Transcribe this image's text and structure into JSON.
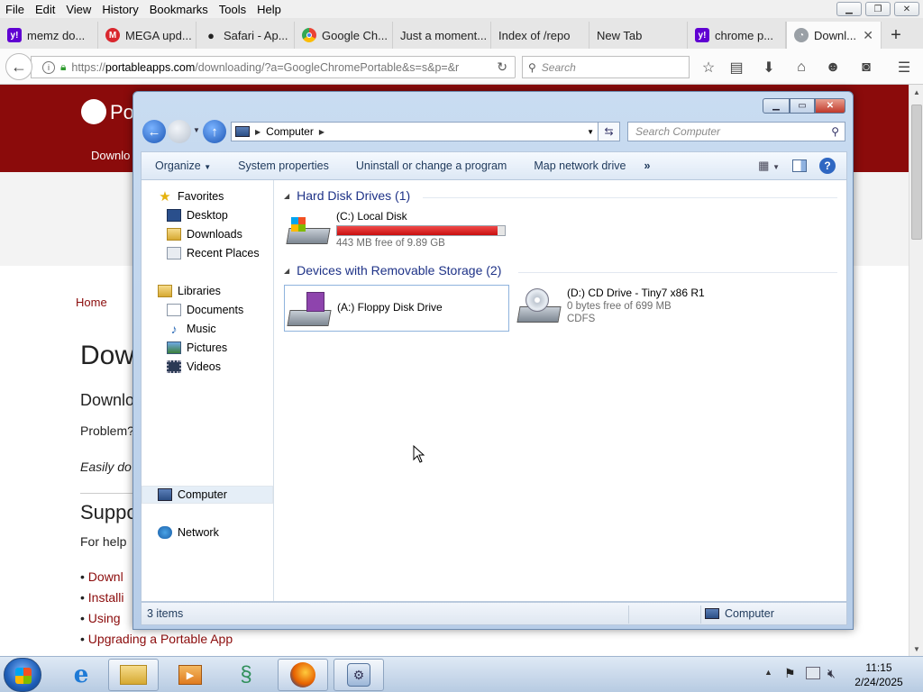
{
  "browser": {
    "menu": [
      "File",
      "Edit",
      "View",
      "History",
      "Bookmarks",
      "Tools",
      "Help"
    ],
    "tabs": [
      {
        "title": "memz do...",
        "icon": "yahoo-icon",
        "color": "#6001d2"
      },
      {
        "title": "MEGA upd...",
        "icon": "mega-icon",
        "color": "#d9272e"
      },
      {
        "title": "Safari - Ap...",
        "icon": "apple-icon",
        "color": "#222222"
      },
      {
        "title": "Google Ch...",
        "icon": "chrome-icon",
        "color": "#4285f4"
      },
      {
        "title": "Just a moment...",
        "icon": "none",
        "color": ""
      },
      {
        "title": "Index of /repo",
        "icon": "none",
        "color": ""
      },
      {
        "title": "New Tab",
        "icon": "none",
        "color": ""
      },
      {
        "title": "chrome p...",
        "icon": "yahoo-icon",
        "color": "#6001d2"
      },
      {
        "title": "Downl...",
        "icon": "portableapps-icon",
        "color": "#8b0b0b",
        "active": true
      }
    ],
    "url_prefix": "https://",
    "url_domain": "portableapps.com",
    "url_rest": "/downloading/?a=GoogleChromePortable&s=s&p=&r",
    "search_placeholder": "Search"
  },
  "webpage": {
    "logo_text": "Po",
    "nav_text": "Downlo",
    "breadcrumb": "Home",
    "heading": "Down",
    "subheading": "Downlo",
    "problem_text": "Problem?",
    "easily_text": "Easily do",
    "support_heading": "Suppo",
    "help_text": "For help",
    "links": [
      "Downl",
      "Installi",
      "Using",
      "Upgrading a Portable App"
    ],
    "accent_color": "#8b0b0b"
  },
  "explorer": {
    "address_root_icon": "computer-icon",
    "address_path": "Computer",
    "search_placeholder": "Search Computer",
    "commands": [
      "Organize",
      "System properties",
      "Uninstall or change a program",
      "Map network drive"
    ],
    "more_label": "»",
    "nav": {
      "favorites": "Favorites",
      "favorites_items": [
        "Desktop",
        "Downloads",
        "Recent Places"
      ],
      "libraries": "Libraries",
      "libraries_items": [
        "Documents",
        "Music",
        "Pictures",
        "Videos"
      ],
      "computer": "Computer",
      "network": "Network"
    },
    "groups": [
      {
        "title": "Hard Disk Drives (1)",
        "drives": [
          {
            "name": "(C:) Local Disk",
            "free": "443 MB free of 9.89 GB",
            "used_fraction": 0.956
          }
        ]
      },
      {
        "title": "Devices with Removable Storage (2)",
        "drives": [
          {
            "name": "(A:) Floppy Disk Drive"
          },
          {
            "name": "(D:) CD Drive - Tiny7 x86 R1",
            "free": "0 bytes free of 699 MB",
            "fs": "CDFS"
          }
        ]
      }
    ],
    "status_items": "3 items",
    "status_location": "Computer"
  },
  "taskbar": {
    "apps": [
      "internet-explorer-icon",
      "windows-explorer-icon",
      "media-player-icon",
      "green-app-icon",
      "firefox-icon",
      "control-panel-icon"
    ],
    "time": "11:15",
    "date": "2/24/2025"
  }
}
